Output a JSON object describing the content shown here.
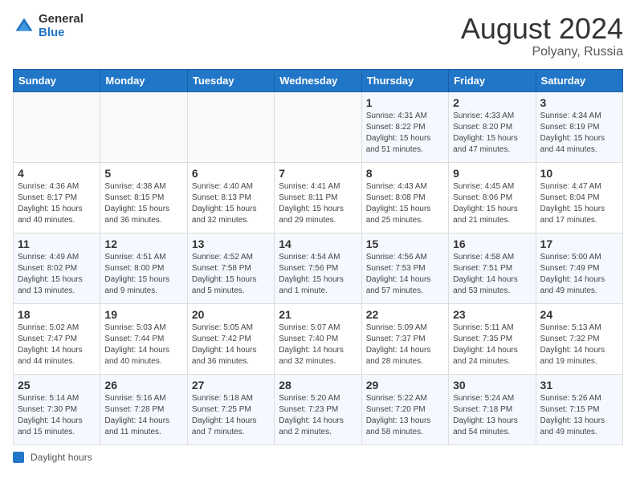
{
  "header": {
    "logo": {
      "general": "General",
      "blue": "Blue"
    },
    "title": "August 2024",
    "location": "Polyany, Russia"
  },
  "days_of_week": [
    "Sunday",
    "Monday",
    "Tuesday",
    "Wednesday",
    "Thursday",
    "Friday",
    "Saturday"
  ],
  "weeks": [
    [
      {
        "day": "",
        "sunrise": "",
        "sunset": "",
        "daylight": ""
      },
      {
        "day": "",
        "sunrise": "",
        "sunset": "",
        "daylight": ""
      },
      {
        "day": "",
        "sunrise": "",
        "sunset": "",
        "daylight": ""
      },
      {
        "day": "",
        "sunrise": "",
        "sunset": "",
        "daylight": ""
      },
      {
        "day": "1",
        "sunrise": "Sunrise: 4:31 AM",
        "sunset": "Sunset: 8:22 PM",
        "daylight": "Daylight: 15 hours and 51 minutes."
      },
      {
        "day": "2",
        "sunrise": "Sunrise: 4:33 AM",
        "sunset": "Sunset: 8:20 PM",
        "daylight": "Daylight: 15 hours and 47 minutes."
      },
      {
        "day": "3",
        "sunrise": "Sunrise: 4:34 AM",
        "sunset": "Sunset: 8:19 PM",
        "daylight": "Daylight: 15 hours and 44 minutes."
      }
    ],
    [
      {
        "day": "4",
        "sunrise": "Sunrise: 4:36 AM",
        "sunset": "Sunset: 8:17 PM",
        "daylight": "Daylight: 15 hours and 40 minutes."
      },
      {
        "day": "5",
        "sunrise": "Sunrise: 4:38 AM",
        "sunset": "Sunset: 8:15 PM",
        "daylight": "Daylight: 15 hours and 36 minutes."
      },
      {
        "day": "6",
        "sunrise": "Sunrise: 4:40 AM",
        "sunset": "Sunset: 8:13 PM",
        "daylight": "Daylight: 15 hours and 32 minutes."
      },
      {
        "day": "7",
        "sunrise": "Sunrise: 4:41 AM",
        "sunset": "Sunset: 8:11 PM",
        "daylight": "Daylight: 15 hours and 29 minutes."
      },
      {
        "day": "8",
        "sunrise": "Sunrise: 4:43 AM",
        "sunset": "Sunset: 8:08 PM",
        "daylight": "Daylight: 15 hours and 25 minutes."
      },
      {
        "day": "9",
        "sunrise": "Sunrise: 4:45 AM",
        "sunset": "Sunset: 8:06 PM",
        "daylight": "Daylight: 15 hours and 21 minutes."
      },
      {
        "day": "10",
        "sunrise": "Sunrise: 4:47 AM",
        "sunset": "Sunset: 8:04 PM",
        "daylight": "Daylight: 15 hours and 17 minutes."
      }
    ],
    [
      {
        "day": "11",
        "sunrise": "Sunrise: 4:49 AM",
        "sunset": "Sunset: 8:02 PM",
        "daylight": "Daylight: 15 hours and 13 minutes."
      },
      {
        "day": "12",
        "sunrise": "Sunrise: 4:51 AM",
        "sunset": "Sunset: 8:00 PM",
        "daylight": "Daylight: 15 hours and 9 minutes."
      },
      {
        "day": "13",
        "sunrise": "Sunrise: 4:52 AM",
        "sunset": "Sunset: 7:58 PM",
        "daylight": "Daylight: 15 hours and 5 minutes."
      },
      {
        "day": "14",
        "sunrise": "Sunrise: 4:54 AM",
        "sunset": "Sunset: 7:56 PM",
        "daylight": "Daylight: 15 hours and 1 minute."
      },
      {
        "day": "15",
        "sunrise": "Sunrise: 4:56 AM",
        "sunset": "Sunset: 7:53 PM",
        "daylight": "Daylight: 14 hours and 57 minutes."
      },
      {
        "day": "16",
        "sunrise": "Sunrise: 4:58 AM",
        "sunset": "Sunset: 7:51 PM",
        "daylight": "Daylight: 14 hours and 53 minutes."
      },
      {
        "day": "17",
        "sunrise": "Sunrise: 5:00 AM",
        "sunset": "Sunset: 7:49 PM",
        "daylight": "Daylight: 14 hours and 49 minutes."
      }
    ],
    [
      {
        "day": "18",
        "sunrise": "Sunrise: 5:02 AM",
        "sunset": "Sunset: 7:47 PM",
        "daylight": "Daylight: 14 hours and 44 minutes."
      },
      {
        "day": "19",
        "sunrise": "Sunrise: 5:03 AM",
        "sunset": "Sunset: 7:44 PM",
        "daylight": "Daylight: 14 hours and 40 minutes."
      },
      {
        "day": "20",
        "sunrise": "Sunrise: 5:05 AM",
        "sunset": "Sunset: 7:42 PM",
        "daylight": "Daylight: 14 hours and 36 minutes."
      },
      {
        "day": "21",
        "sunrise": "Sunrise: 5:07 AM",
        "sunset": "Sunset: 7:40 PM",
        "daylight": "Daylight: 14 hours and 32 minutes."
      },
      {
        "day": "22",
        "sunrise": "Sunrise: 5:09 AM",
        "sunset": "Sunset: 7:37 PM",
        "daylight": "Daylight: 14 hours and 28 minutes."
      },
      {
        "day": "23",
        "sunrise": "Sunrise: 5:11 AM",
        "sunset": "Sunset: 7:35 PM",
        "daylight": "Daylight: 14 hours and 24 minutes."
      },
      {
        "day": "24",
        "sunrise": "Sunrise: 5:13 AM",
        "sunset": "Sunset: 7:32 PM",
        "daylight": "Daylight: 14 hours and 19 minutes."
      }
    ],
    [
      {
        "day": "25",
        "sunrise": "Sunrise: 5:14 AM",
        "sunset": "Sunset: 7:30 PM",
        "daylight": "Daylight: 14 hours and 15 minutes."
      },
      {
        "day": "26",
        "sunrise": "Sunrise: 5:16 AM",
        "sunset": "Sunset: 7:28 PM",
        "daylight": "Daylight: 14 hours and 11 minutes."
      },
      {
        "day": "27",
        "sunrise": "Sunrise: 5:18 AM",
        "sunset": "Sunset: 7:25 PM",
        "daylight": "Daylight: 14 hours and 7 minutes."
      },
      {
        "day": "28",
        "sunrise": "Sunrise: 5:20 AM",
        "sunset": "Sunset: 7:23 PM",
        "daylight": "Daylight: 14 hours and 2 minutes."
      },
      {
        "day": "29",
        "sunrise": "Sunrise: 5:22 AM",
        "sunset": "Sunset: 7:20 PM",
        "daylight": "Daylight: 13 hours and 58 minutes."
      },
      {
        "day": "30",
        "sunrise": "Sunrise: 5:24 AM",
        "sunset": "Sunset: 7:18 PM",
        "daylight": "Daylight: 13 hours and 54 minutes."
      },
      {
        "day": "31",
        "sunrise": "Sunrise: 5:26 AM",
        "sunset": "Sunset: 7:15 PM",
        "daylight": "Daylight: 13 hours and 49 minutes."
      }
    ]
  ],
  "legend": {
    "daylight_label": "Daylight hours"
  }
}
